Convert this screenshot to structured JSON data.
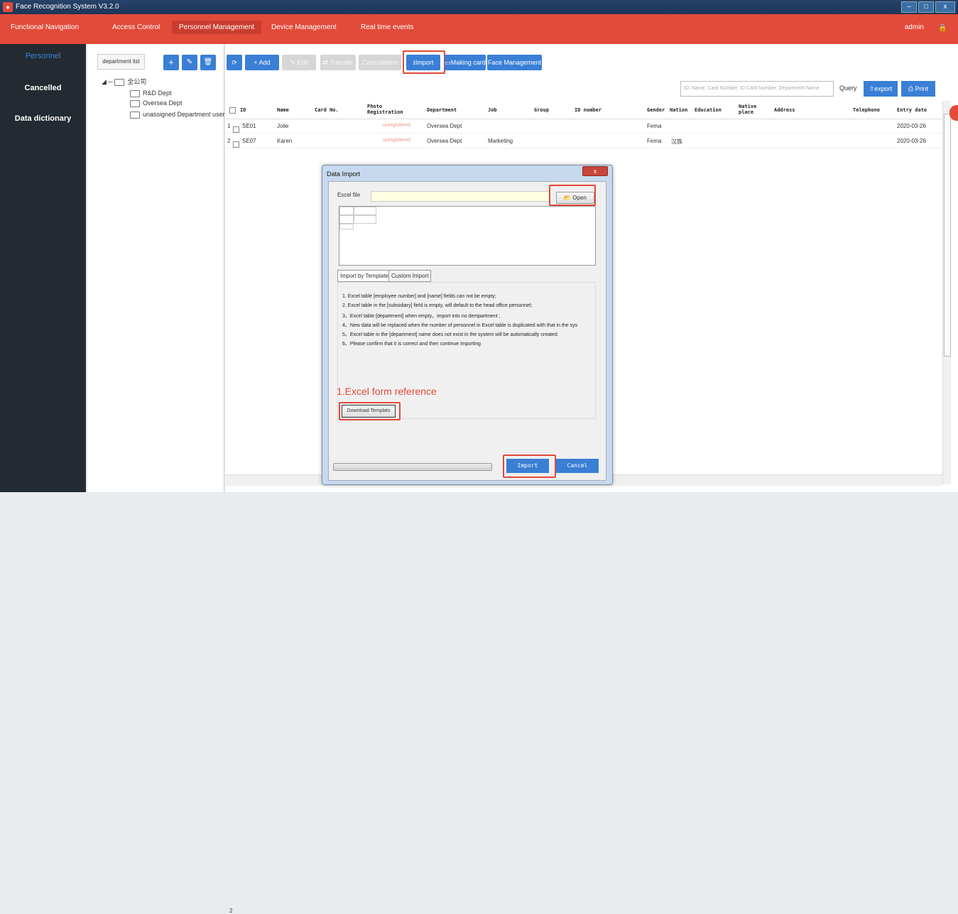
{
  "window": {
    "title": "Face Recognition System V3.2.0"
  },
  "menu": {
    "items": [
      "Functional Navigation",
      "Access Control",
      "Personnel Management",
      "Device Management",
      "Real time events"
    ],
    "active": "Personnel Management",
    "user": "admin"
  },
  "sidebar": {
    "items": [
      "Personnel",
      "Cancelled",
      "Data dictionary"
    ],
    "active": "Personnel"
  },
  "dept_panel": {
    "label": "department list",
    "tree": [
      "全公司",
      "R&D Dept",
      "Oversea Dept",
      "unassigned Department users"
    ]
  },
  "toolbar": {
    "add": "Add",
    "edit": "Edit",
    "transfer": "Transfer",
    "cancellation": "Cancellation",
    "import": "Import",
    "making_card": "Making card",
    "face_management": "Face Management"
  },
  "search": {
    "placeholder": "ID, Name, Card Number, ID Card Number, Department Name",
    "query": "Query",
    "export": "export",
    "print": "Print"
  },
  "table": {
    "columns": [
      "ID",
      "Name",
      "Card No.",
      "Photo Registration",
      "Department",
      "Job",
      "Group",
      "ID number",
      "Gender",
      "Nation",
      "Education",
      "Native place",
      "Address",
      "Telephone",
      "Entry date"
    ],
    "rows": [
      {
        "num": "1",
        "id": "SE01",
        "name": "Jolie",
        "photo": "unregistered",
        "dept": "Oversea Dept",
        "job": "",
        "gender": "Fema",
        "nation": "",
        "entry": "2020-03-26"
      },
      {
        "num": "2",
        "id": "SE07",
        "name": "Karen",
        "photo": "unregistered",
        "dept": "Oversea Dept",
        "job": "Marketing",
        "gender": "Fema",
        "nation": "汉族",
        "entry": "2020-03-26"
      }
    ],
    "page": "2"
  },
  "dialog": {
    "title": "Data Import",
    "excel_label": "Excel file",
    "open": "Open",
    "tabs": [
      "Import by Template",
      "Custom Import"
    ],
    "instructions": [
      "1. Excel table [employee number] and [name] fields can not be empty;",
      "2. Excel table in the [subsidiary] field is empty, will default to the head office personnel;",
      "3、Excel table [department] when empty，import into no dempartment ;",
      "4、New data will be replaced when the number of personnel in Excel table is duplicated with that in the sys",
      "5、Excel table in the [department] name does not exist in the system will be automatically created",
      "6、Please confirm that it is correct and then continue importing"
    ],
    "reference": "1.Excel form reference",
    "download": "Download Templats",
    "import": "Import",
    "cancel": "Cancel"
  },
  "colors": {
    "brand_red": "#e24a3a",
    "button_blue": "#3a7fd6",
    "sidebar": "#232a31"
  }
}
